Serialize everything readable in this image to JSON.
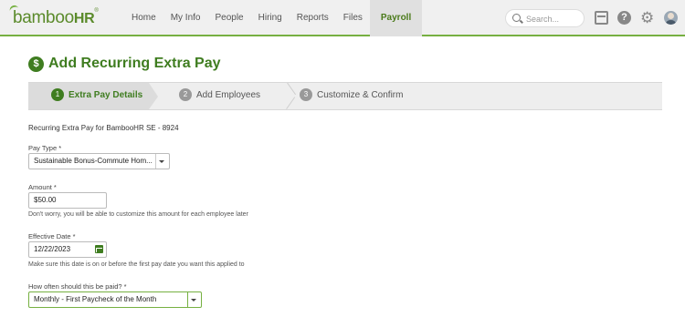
{
  "logo": {
    "text_main": "bamboo",
    "text_hr": "HR",
    "reg": "®"
  },
  "nav": {
    "items": [
      {
        "label": "Home"
      },
      {
        "label": "My Info"
      },
      {
        "label": "People"
      },
      {
        "label": "Hiring"
      },
      {
        "label": "Reports"
      },
      {
        "label": "Files"
      },
      {
        "label": "Payroll",
        "active": true
      }
    ],
    "search_placeholder": "Search...",
    "help_glyph": "?",
    "gear_glyph": "⚙"
  },
  "page": {
    "title": "Add Recurring Extra Pay",
    "title_icon_glyph": "$"
  },
  "stepper": {
    "steps": [
      {
        "num": "1",
        "label": "Extra Pay Details",
        "active": true
      },
      {
        "num": "2",
        "label": "Add Employees",
        "active": false
      },
      {
        "num": "3",
        "label": "Customize & Confirm",
        "active": false
      }
    ]
  },
  "form": {
    "subtitle": "Recurring Extra Pay for BambooHR SE - 8924",
    "pay_type": {
      "label": "Pay Type *",
      "value": "Sustainable Bonus-Commute Hom..."
    },
    "amount": {
      "label": "Amount *",
      "value": "$50.00",
      "hint": "Don't worry, you will be able to customize this amount for each employee later"
    },
    "effective_date": {
      "label": "Effective Date *",
      "value": "12/22/2023",
      "hint": "Make sure this date is on or before the first pay date you want this applied to"
    },
    "frequency": {
      "label": "How often should this be paid? *",
      "value": "Monthly - First Paycheck of the Month"
    }
  },
  "colors": {
    "brand_green": "#3f7d20",
    "accent_green": "#76b041"
  }
}
